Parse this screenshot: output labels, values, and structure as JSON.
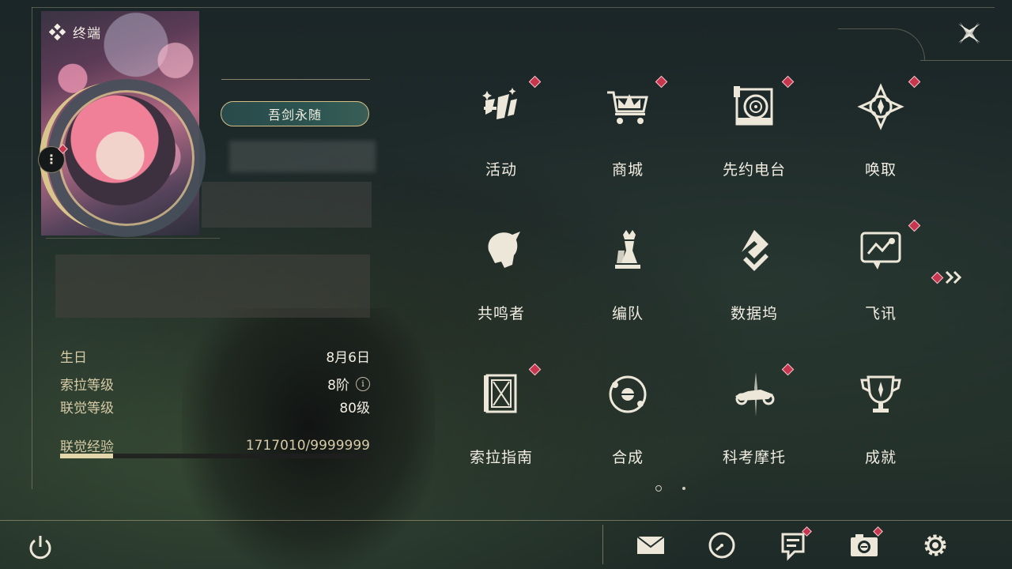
{
  "header": {
    "title": "终端",
    "title_icon": "diamond-cluster-icon",
    "close_icon": "close-icon"
  },
  "profile": {
    "signature": "吾剑永随",
    "avatar_menu": "⋮",
    "stats": {
      "birthday_label": "生日",
      "birthday_value": "8月6日",
      "sola_level_label": "索拉等级",
      "sola_level_value": "8阶",
      "union_level_label": "联觉等级",
      "union_level_value": "80级",
      "union_exp_label": "联觉经验",
      "union_exp_value": "1717010/9999999",
      "union_exp_progress": 0.17
    },
    "info_glyph": "i"
  },
  "menu": {
    "items": [
      {
        "label": "活动",
        "icon": "events-icon",
        "badge": true
      },
      {
        "label": "商城",
        "icon": "shop-crown-cart-icon",
        "badge": true
      },
      {
        "label": "先约电台",
        "icon": "radio-record-icon",
        "badge": true
      },
      {
        "label": "唤取",
        "icon": "convene-compass-icon",
        "badge": true
      },
      {
        "label": "共鸣者",
        "icon": "resonator-head-icon",
        "badge": false
      },
      {
        "label": "编队",
        "icon": "team-chess-icon",
        "badge": false
      },
      {
        "label": "数据坞",
        "icon": "data-bank-icon",
        "badge": false
      },
      {
        "label": "飞讯",
        "icon": "message-chat-icon",
        "badge": true
      },
      {
        "label": "索拉指南",
        "icon": "guide-book-icon",
        "badge": true
      },
      {
        "label": "合成",
        "icon": "synthesis-orbit-icon",
        "badge": false
      },
      {
        "label": "科考摩托",
        "icon": "motorbike-icon",
        "badge": true
      },
      {
        "label": "成就",
        "icon": "achievement-trophy-icon",
        "badge": false
      }
    ],
    "next_page_icon": "double-chevron-right-icon",
    "pages": 2,
    "current_page": 1
  },
  "bottom_bar": {
    "power_icon": "power-icon",
    "buttons": [
      {
        "icon": "mail-icon",
        "badge": false
      },
      {
        "icon": "clock-icon",
        "badge": false
      },
      {
        "icon": "notice-list-icon",
        "badge": true
      },
      {
        "icon": "camera-icon",
        "badge": true
      },
      {
        "icon": "settings-gear-icon",
        "badge": false
      }
    ]
  },
  "colors": {
    "accent_gold": "#d8c58c",
    "badge_red": "#c7364f",
    "text_primary": "#f1ede2",
    "text_label": "#d6cba6"
  }
}
